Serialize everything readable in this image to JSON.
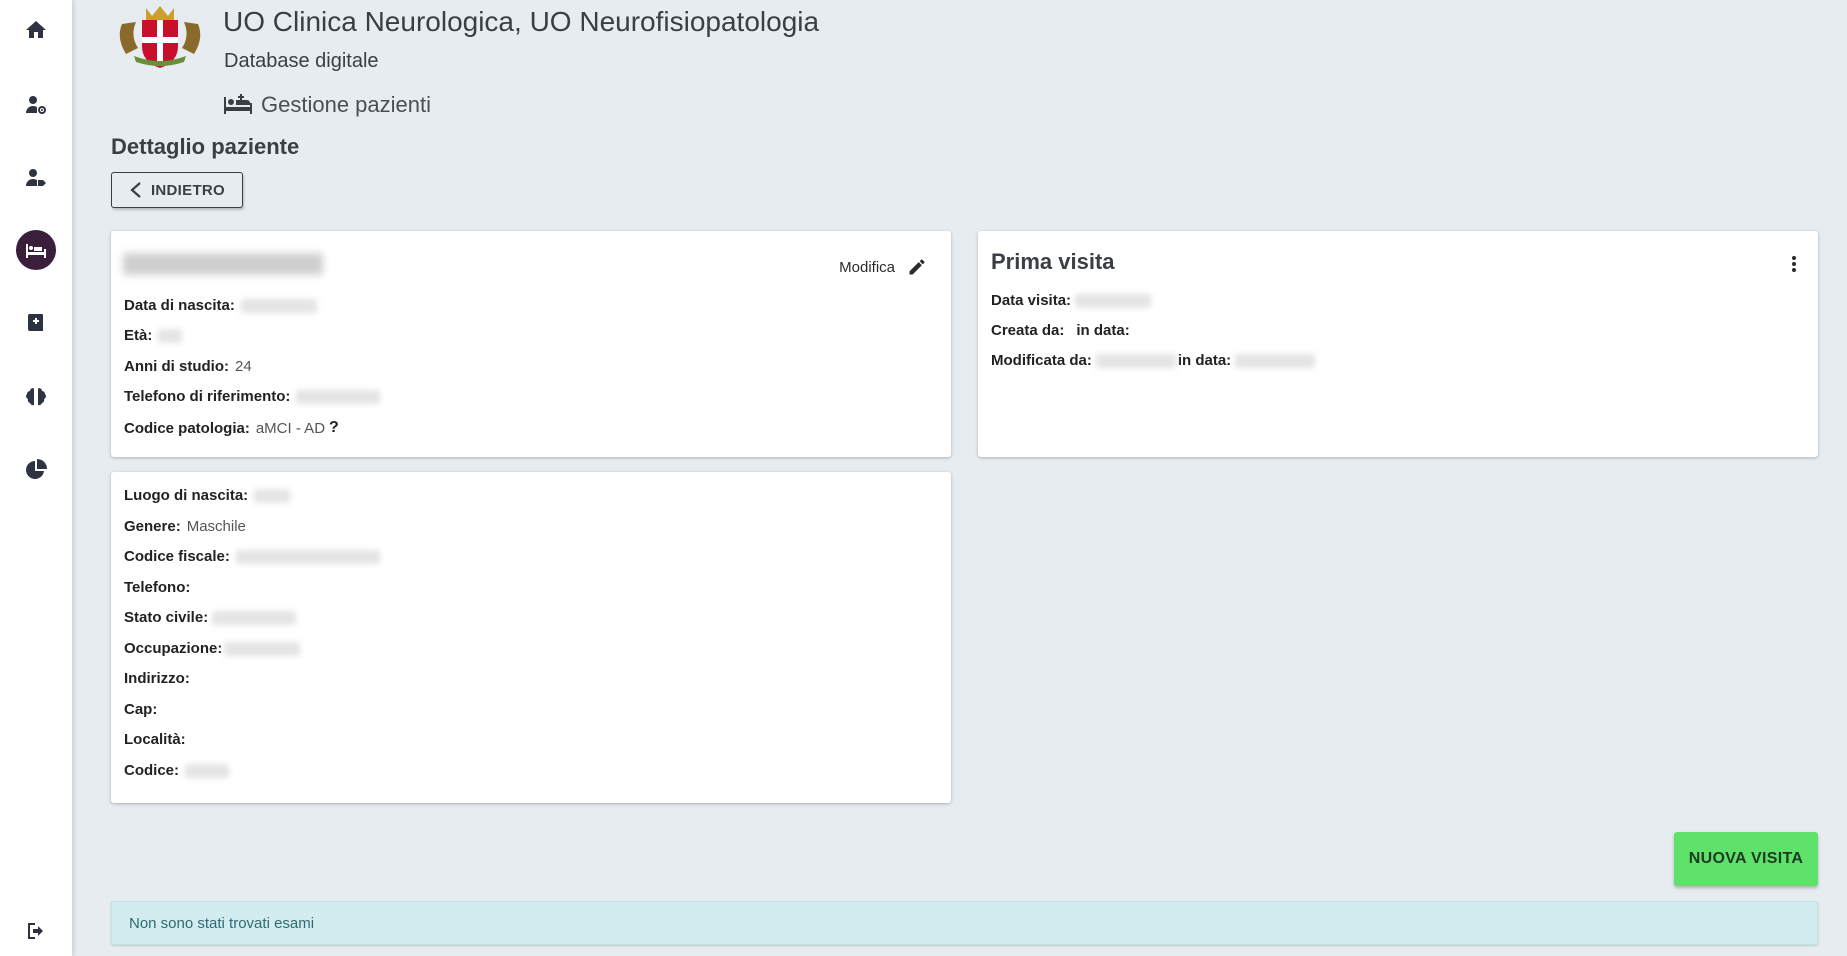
{
  "sidebar": {
    "items": [
      {
        "icon": "home-icon"
      },
      {
        "icon": "user-settings-icon"
      },
      {
        "icon": "user-tag-icon"
      },
      {
        "icon": "patient-bed-icon",
        "active": true
      },
      {
        "icon": "medical-book-icon"
      },
      {
        "icon": "brain-icon"
      },
      {
        "icon": "pie-chart-icon"
      }
    ],
    "logout_icon": "logout-icon"
  },
  "header": {
    "title": "UO Clinica Neurologica, UO Neurofisiopatologia",
    "subtitle": "Database digitale",
    "section": "Gestione pazienti"
  },
  "page": {
    "title": "Dettaglio paziente",
    "back_label": "INDIETRO"
  },
  "patient_card": {
    "edit_label": "Modifica",
    "fields": [
      {
        "label": "Data di nascita:",
        "value": ""
      },
      {
        "label": "Età:",
        "value": ""
      },
      {
        "label": "Anni di studio:",
        "value": "24"
      },
      {
        "label": "Telefono di riferimento:",
        "value": ""
      },
      {
        "label": "Codice patologia:",
        "value": "aMCI - AD"
      }
    ]
  },
  "visit_card": {
    "title": "Prima visita",
    "data_visita_label": "Data visita:",
    "creata_da_label": "Creata da:",
    "in_data_label": "in data:",
    "modificata_da_label": "Modificata da:",
    "modificata_in_data_label": "in data:"
  },
  "details_card": {
    "fields": [
      {
        "label": "Luogo di nascita:",
        "value": ""
      },
      {
        "label": "Genere:",
        "value": "Maschile"
      },
      {
        "label": "Codice fiscale:",
        "value": ""
      },
      {
        "label": "Telefono:",
        "value": ""
      },
      {
        "label": "Stato civile:",
        "value": ""
      },
      {
        "label": "Occupazione:",
        "value": ""
      },
      {
        "label": "Indirizzo:",
        "value": ""
      },
      {
        "label": "Cap:",
        "value": ""
      },
      {
        "label": "Località:",
        "value": ""
      },
      {
        "label": "Codice:",
        "value": ""
      }
    ]
  },
  "actions": {
    "new_visit_label": "NUOVA VISITA"
  },
  "alert": {
    "message": "Non sono stati trovati esami"
  },
  "colors": {
    "background": "#e6ecef",
    "active_nav": "#3a1f3a",
    "new_visit": "#5ee26a",
    "alert_bg": "#d2ecef"
  }
}
